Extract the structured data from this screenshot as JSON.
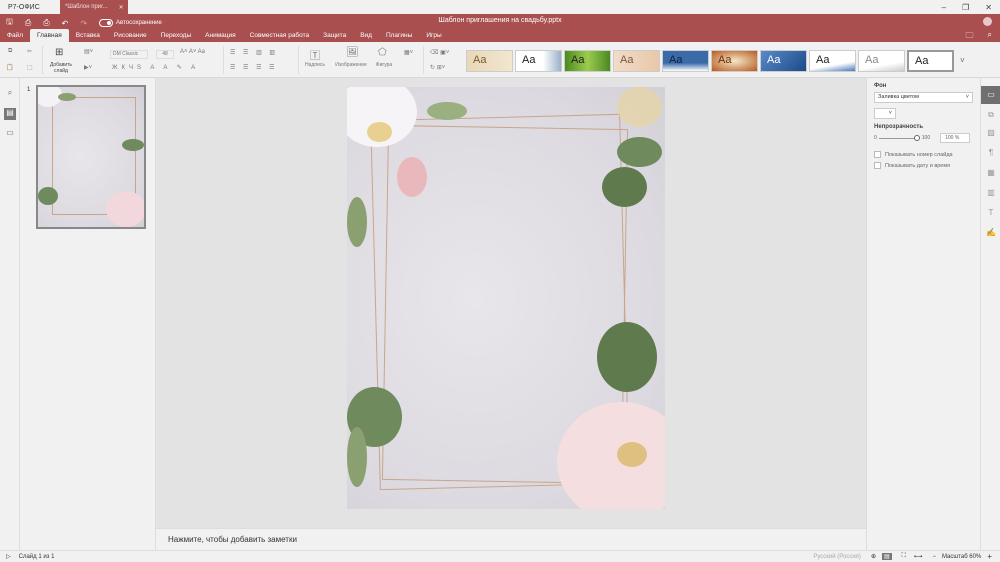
{
  "app": {
    "name": "Р7-ОФИС",
    "doc_tab": "*Шаблон приг...",
    "title": "Шаблон приглашения на свадьбу.pptx",
    "autosave": "Автосохранение"
  },
  "tabs": [
    "Файл",
    "Главная",
    "Вставка",
    "Рисование",
    "Переходы",
    "Анимация",
    "Совместная работа",
    "Защита",
    "Вид",
    "Плагины",
    "Игры"
  ],
  "ribbon": {
    "add_slide": "Добавить слайд",
    "font": "DM Classic",
    "size": "48",
    "caption": "Надпись",
    "image": "Изображение",
    "shape": "Фигура"
  },
  "themes": [
    "Aa",
    "Aa",
    "Aa",
    "Aa",
    "Aa",
    "Aa",
    "Aa",
    "Aa",
    "Aa",
    "Aa"
  ],
  "thumbnails": [
    {
      "number": "1"
    }
  ],
  "notes_placeholder": "Нажмите, чтобы добавить заметки",
  "right_panel": {
    "bg_label": "Фон",
    "fill": "Заливка цветом",
    "opacity_label": "Непрозрачность",
    "min": "0",
    "max": "100",
    "opacity_value": "100 %",
    "show_slide_number": "Показывать номер слайда",
    "show_date": "Показывать дату и время"
  },
  "status": {
    "slide_of": "Слайд 1 из 1",
    "language": "Русский (Россия)",
    "zoom": "Масштаб 60%"
  },
  "colors": {
    "accent": "#a94f50"
  }
}
